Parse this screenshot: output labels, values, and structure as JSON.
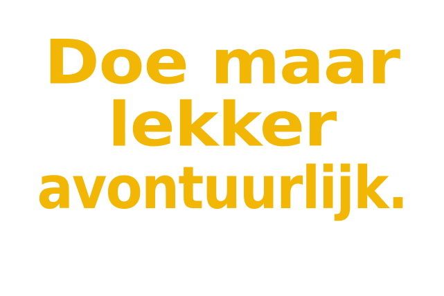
{
  "headline": {
    "line1": "Doe maar",
    "line2": "lekker",
    "line3": "avontuurlijk."
  },
  "colors": {
    "text": "#f2b705",
    "background": "#ffffff"
  }
}
